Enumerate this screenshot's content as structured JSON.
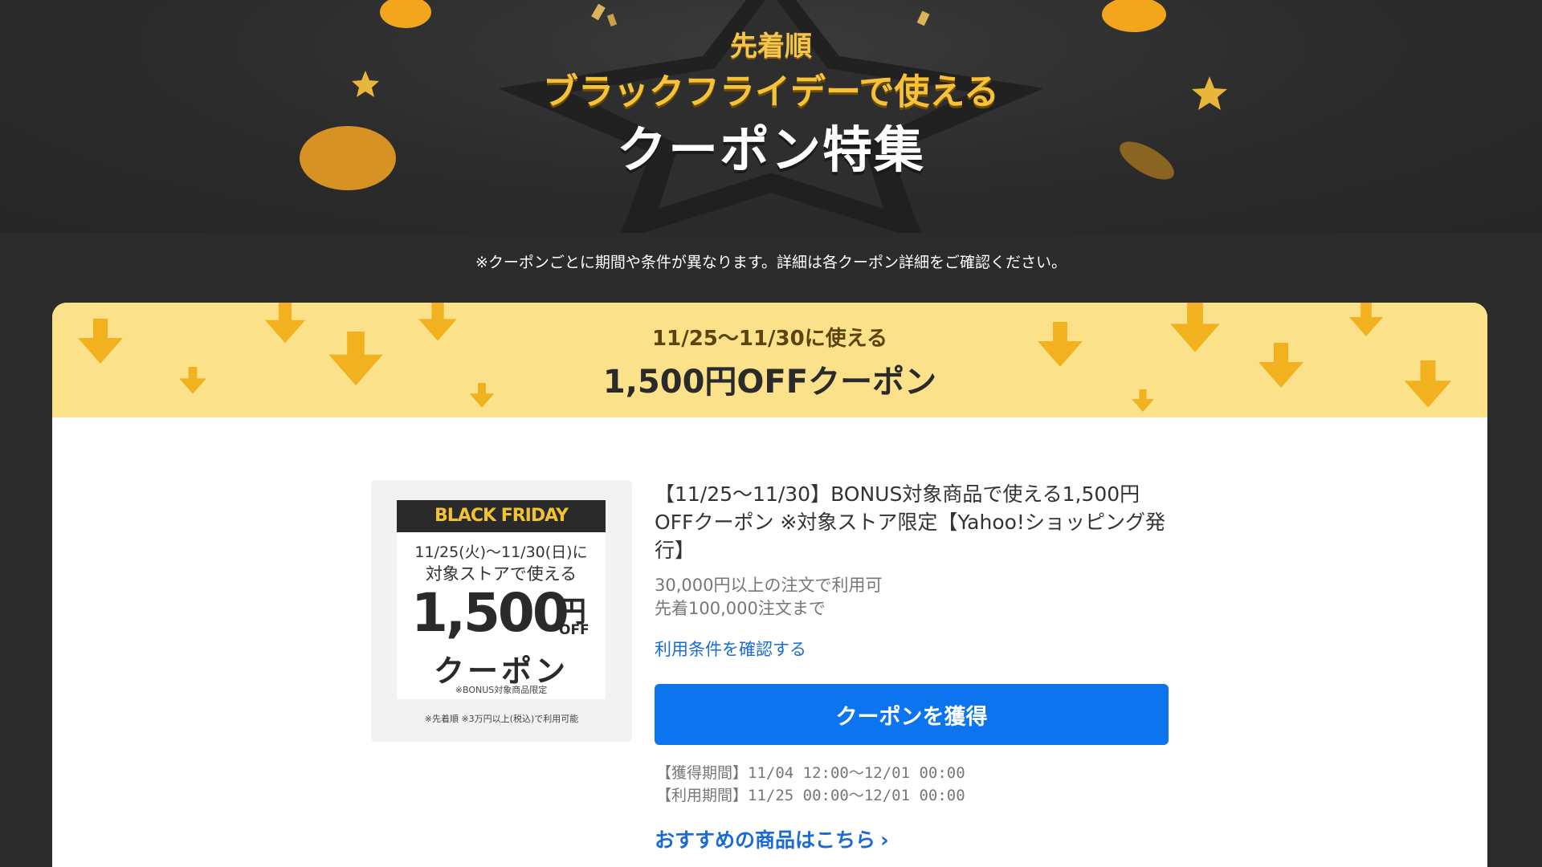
{
  "hero": {
    "pre_title": "先着順",
    "subtitle": "ブラックフライデーで使える",
    "title": "クーポン特集"
  },
  "notice": "※クーポンごとに期間や条件が異なります。詳細は各クーポン詳細をご確認ください。",
  "section": {
    "pre_title": "11/25〜11/30に使える",
    "title": "1,500円OFFクーポン"
  },
  "coupon": {
    "image": {
      "badge": "BLACK FRIDAY",
      "dates": "11/25(火)〜11/30(日)に",
      "store_text": "対象ストアで使える",
      "amount": "1,500",
      "yen": "円",
      "off": "OFF",
      "coupon_word": "クーポン",
      "note": "※BONUS対象商品限定",
      "footnote": "※先着順 ※3万円以上(税込)で利用可能"
    },
    "title": "【11/25〜11/30】BONUS対象商品で使える1,500円OFFクーポン ※対象ストア限定【Yahoo!ショッピング発行】",
    "conditions": [
      "30,000円以上の注文で利用可",
      "先着100,000注文まで"
    ],
    "terms_link": "利用条件を確認する",
    "get_button": "クーポンを獲得",
    "acquire_period": "【獲得期間】11/04 12:00〜12/01 00:00",
    "use_period": "【利用期間】11/25 00:00〜12/01 00:00",
    "recommend_link": "おすすめの商品はこちら"
  },
  "colors": {
    "background": "#2b2b2b",
    "gold": "#f7c13a",
    "banner": "#fbe28a",
    "button": "#0d74f0",
    "link": "#1a6bd8"
  }
}
